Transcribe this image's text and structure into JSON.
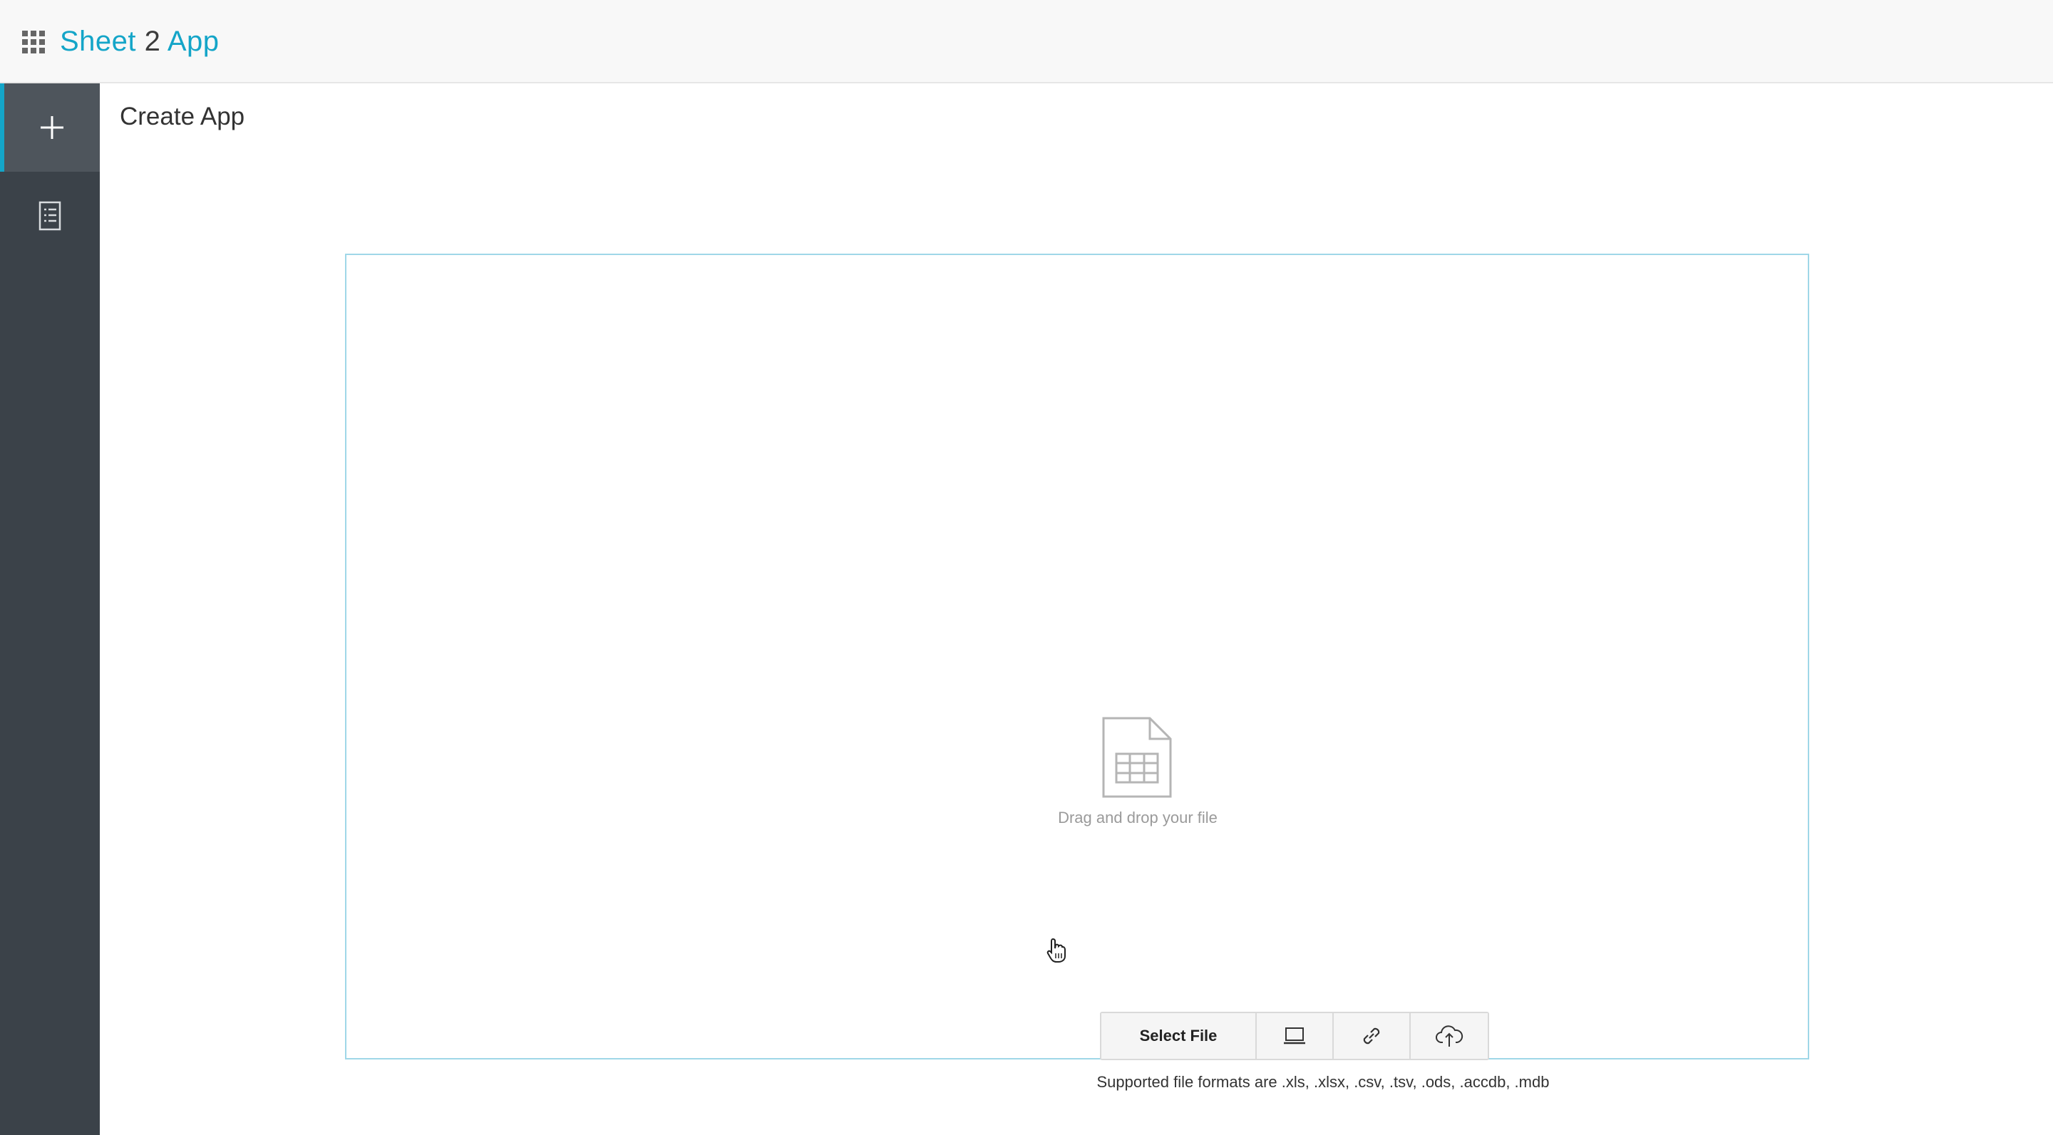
{
  "header": {
    "brand_part1": "Sheet",
    "brand_part2": "2",
    "brand_part3": "App"
  },
  "sidebar": {
    "items": [
      {
        "name": "create",
        "icon": "plus-icon",
        "active": true
      },
      {
        "name": "apps",
        "icon": "document-list-icon",
        "active": false
      }
    ]
  },
  "main": {
    "title": "Create App",
    "dropzone": {
      "drag_text": "Drag and drop your file",
      "select_label": "Select File",
      "source_icons": [
        "computer-icon",
        "link-icon",
        "cloud-upload-icon"
      ],
      "formats_text": "Supported file formats are .xls, .xlsx, .csv, .tsv, .ods, .accdb, .mdb"
    }
  },
  "colors": {
    "accent": "#14a5c8",
    "sidebar": "#3b4249",
    "sidebar_active": "#4e555c",
    "dropzone_border": "#9fd7e8"
  }
}
